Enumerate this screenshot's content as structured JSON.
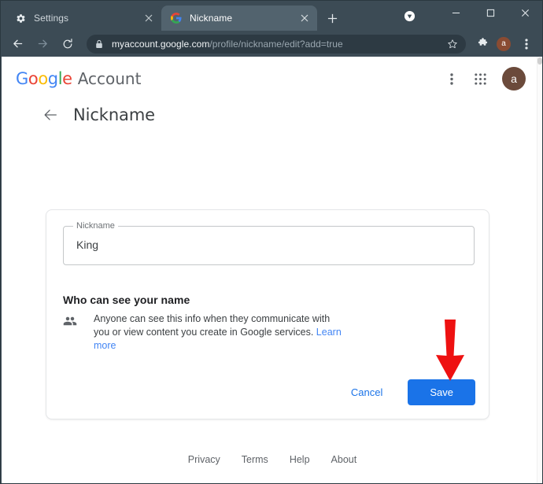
{
  "browser": {
    "tabs": [
      {
        "title": "Settings",
        "favicon": "gear-icon",
        "active": false
      },
      {
        "title": "Nickname",
        "favicon": "google-g-icon",
        "active": true
      }
    ],
    "new_tab_label": "+",
    "window_controls": {
      "minimize": "–",
      "maximize": "□",
      "close": "✕"
    },
    "media_indicator_icon": "media-control-icon",
    "nav": {
      "back_icon": "back-arrow-icon",
      "forward_icon": "forward-arrow-icon",
      "reload_icon": "reload-icon"
    },
    "omnibox": {
      "lock_icon": "lock-icon",
      "host": "myaccount.google.com",
      "path": "/profile/nickname/edit?add=true",
      "star_icon": "bookmark-star-icon"
    },
    "extensions_icon": "puzzle-piece-icon",
    "profile_avatar_letter": "a",
    "menu_icon": "three-dot-menu-icon"
  },
  "page": {
    "header": {
      "logo_letters": [
        "G",
        "o",
        "o",
        "g",
        "l",
        "e"
      ],
      "product_name": "Account",
      "overflow_icon": "three-dot-menu-icon",
      "apps_icon": "google-apps-grid-icon",
      "avatar_letter": "a"
    },
    "back_icon": "back-arrow-icon",
    "title": "Nickname",
    "form": {
      "field_label": "Nickname",
      "field_value": "King",
      "field_placeholder": "Nickname"
    },
    "visibility": {
      "heading": "Who can see your name",
      "icon": "people-group-icon",
      "body": "Anyone can see this info when they communicate with you or view content you create in Google services.",
      "link_text": "Learn more"
    },
    "buttons": {
      "cancel": "Cancel",
      "save": "Save"
    },
    "annotation": {
      "type": "red-down-arrow",
      "color": "#EE1111",
      "points_to": "save-button"
    },
    "footer_links": [
      "Privacy",
      "Terms",
      "Help",
      "About"
    ]
  },
  "colors": {
    "chrome_frame": "#3c4b55",
    "chrome_active_tab": "#52636e",
    "omnibox_bg": "#2d3a43",
    "accent_blue": "#1a73e8",
    "link_blue": "#4285F4",
    "annotation_red": "#EE1111",
    "avatar_brown": "#6b4a3b"
  }
}
